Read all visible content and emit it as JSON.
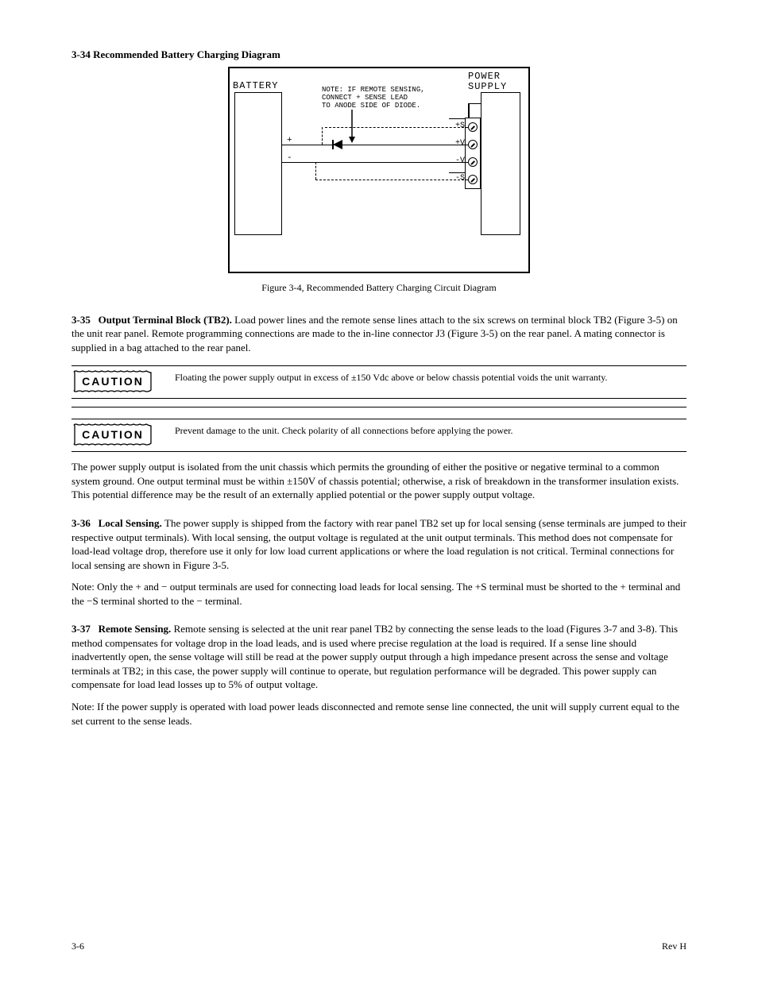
{
  "fig34": {
    "title_line": "3-34 Recommended Battery Charging Diagram",
    "battery_label": "BATTERY",
    "power_label_1": "POWER",
    "power_label_2": "SUPPLY",
    "note_l1": "NOTE: IF REMOTE SENSING,",
    "note_l2": "CONNECT + SENSE LEAD",
    "note_l3": "TO ANODE SIDE OF DIODE.",
    "terminals": {
      "ps": [
        "+S",
        "+V",
        "-V",
        "-S"
      ]
    },
    "batt_plus": "+",
    "batt_minus": "-",
    "caption": "Figure 3-4, Recommended Battery Charging Circuit Diagram"
  },
  "sec335": {
    "num": "3-35",
    "title": "Output Terminal Block (TB2).",
    "body": "Load power lines and the remote sense lines attach to the six screws on terminal block TB2 (Figure 3-5) on the unit rear panel. Remote programming connections are made to the in-line connector J3 (Figure 3-5) on the rear panel. A mating connector is supplied in a bag attached to the rear panel."
  },
  "caution1": "Floating the power supply output in excess of ±150 Vdc above or below chassis potential voids the unit warranty.",
  "caution2": "Prevent damage to the unit. Check polarity of all connections before applying the power.",
  "para_isolation": "The power supply output is isolated from the unit chassis which permits the grounding of either the positive or negative terminal to a common system ground. One output terminal must be within ±150V of chassis potential; otherwise, a risk of breakdown in the transformer insulation exists. This potential difference may be the result of an externally applied potential or the power supply output voltage.",
  "sec336": {
    "num": "3-36",
    "title": "Local Sensing.",
    "body": "The power supply is shipped from the factory with rear panel TB2 set up for local sensing (sense terminals are jumped to their respective output terminals). With local sensing, the output voltage is regulated at the unit output terminals. This method does not compensate for load-lead voltage drop, therefore use it only for low load current applications or where the load regulation is not critical. Terminal connections for local sensing are shown in Figure 3-5.",
    "note": "Note:  Only the + and − output terminals are used for connecting load leads for local sensing. The +S terminal must be shorted to the + terminal and the −S terminal shorted to the − terminal."
  },
  "sec337": {
    "num": "3-37",
    "title": "Remote Sensing.",
    "body": "Remote sensing is selected at the unit rear panel TB2 by connecting the sense leads to the load (Figures 3-7 and 3-8). This method compensates for voltage drop in the load leads, and is used where precise regulation at the load is required. If a sense line should inadvertently open, the sense voltage will still be read at the power supply output through a high impedance present across the sense and voltage terminals at TB2; in this case, the power supply will continue to operate, but regulation performance will be degraded. This power supply can compensate for load lead losses up to 5% of output voltage.",
    "note": "Note:  If the power supply is operated with load power leads disconnected and remote sense line connected, the unit will supply current equal to the set current to the sense leads."
  },
  "page_label": "3-6",
  "rev_label": "Rev H"
}
